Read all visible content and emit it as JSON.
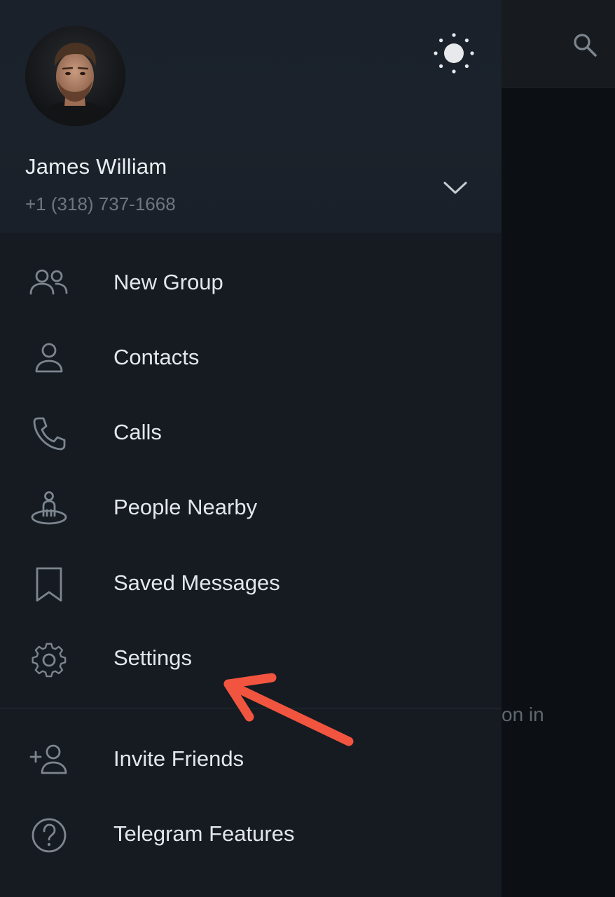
{
  "background": {
    "fragment_text": "on in"
  },
  "profile": {
    "name": "James William",
    "phone": "+1 (318) 737-1668"
  },
  "menu": {
    "items": [
      {
        "label": "New Group",
        "icon": "group-icon"
      },
      {
        "label": "Contacts",
        "icon": "contact-icon"
      },
      {
        "label": "Calls",
        "icon": "phone-icon"
      },
      {
        "label": "People Nearby",
        "icon": "people-nearby-icon"
      },
      {
        "label": "Saved Messages",
        "icon": "bookmark-icon"
      },
      {
        "label": "Settings",
        "icon": "gear-icon"
      }
    ],
    "secondary_items": [
      {
        "label": "Invite Friends",
        "icon": "add-user-icon"
      },
      {
        "label": "Telegram Features",
        "icon": "question-icon"
      }
    ]
  },
  "colors": {
    "drawer_bg": "#161b22",
    "header_bg": "#1b222b",
    "text_primary": "#e3e7eb",
    "text_secondary": "#6e7781",
    "icon": "#7d858e",
    "annotation_arrow": "#f2553f"
  }
}
